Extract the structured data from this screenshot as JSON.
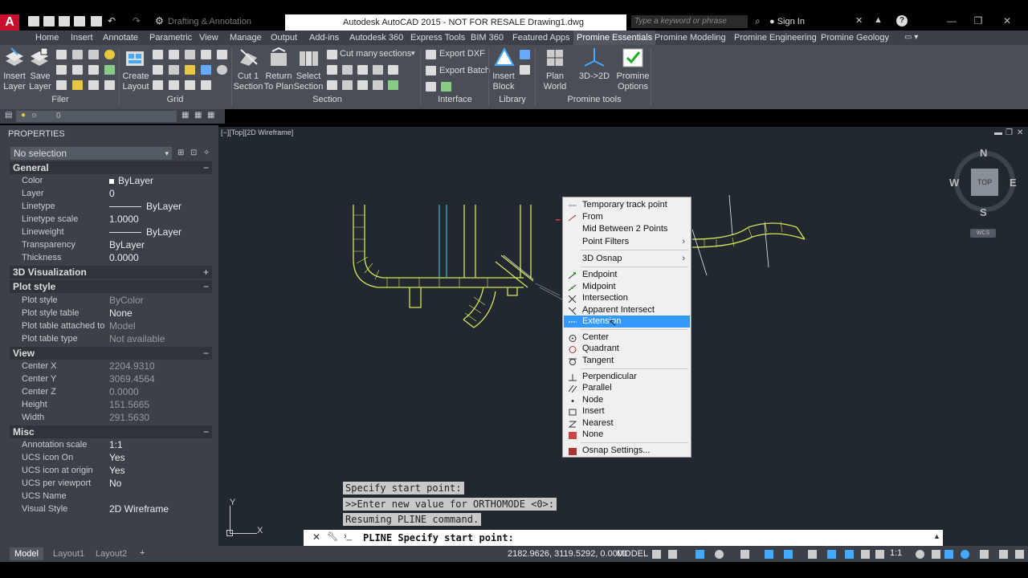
{
  "titlebar": {
    "workspace": "Drafting & Annotation",
    "title": "Autodesk AutoCAD 2015 - NOT FOR RESALE    Drawing1.dwg",
    "search_placeholder": "Type a keyword or phrase",
    "signin": "Sign In"
  },
  "tabs": [
    {
      "label": "Home"
    },
    {
      "label": "Insert"
    },
    {
      "label": "Annotate"
    },
    {
      "label": "Parametric"
    },
    {
      "label": "View"
    },
    {
      "label": "Manage"
    },
    {
      "label": "Output"
    },
    {
      "label": "Add-ins"
    },
    {
      "label": "Autodesk 360"
    },
    {
      "label": "Express Tools"
    },
    {
      "label": "BIM 360"
    },
    {
      "label": "Featured Apps"
    },
    {
      "label": "Promine Essentials"
    },
    {
      "label": "Promine Modeling"
    },
    {
      "label": "Promine Engineering"
    },
    {
      "label": "Promine Geology"
    }
  ],
  "ribbon": {
    "insert_layer": [
      "Insert",
      "Layer"
    ],
    "save_layer": [
      "Save",
      "Layer"
    ],
    "create_layout": [
      "Create",
      "Layout"
    ],
    "cut1_section": [
      "Cut 1",
      "Section"
    ],
    "return_to_plan": [
      "Return",
      "To Plan"
    ],
    "select_section": [
      "Select",
      "Section"
    ],
    "cut_many": "Cut many",
    "sections": "sections",
    "export_dxf": "Export DXF",
    "export_batch": "Export Batch",
    "insert_block": [
      "Insert",
      "Block"
    ],
    "plan_world": [
      "Plan",
      "World"
    ],
    "three_d_to_2d": "3D->2D",
    "promine_options": [
      "Promine",
      "Options"
    ],
    "panels": {
      "filer": "Filer",
      "grid": "Grid",
      "section": "Section",
      "interface": "Interface",
      "library": "Library",
      "promine_tools": "Promine tools"
    }
  },
  "layerbar": {
    "layer": "0"
  },
  "properties": {
    "title": "PROPERTIES",
    "selection": "No selection",
    "general": {
      "title": "General",
      "rows": [
        {
          "k": "Color",
          "v": "ByLayer"
        },
        {
          "k": "Layer",
          "v": "0"
        },
        {
          "k": "Linetype",
          "v": "ByLayer"
        },
        {
          "k": "Linetype scale",
          "v": "1.0000"
        },
        {
          "k": "Lineweight",
          "v": "ByLayer"
        },
        {
          "k": "Transparency",
          "v": "ByLayer"
        },
        {
          "k": "Thickness",
          "v": "0.0000"
        }
      ]
    },
    "viz_title": "3D Visualization",
    "plot": {
      "title": "Plot style",
      "rows": [
        {
          "k": "Plot style",
          "v": "ByColor"
        },
        {
          "k": "Plot style table",
          "v": "None"
        },
        {
          "k": "Plot table attached to",
          "v": "Model"
        },
        {
          "k": "Plot table type",
          "v": "Not available"
        }
      ]
    },
    "view": {
      "title": "View",
      "rows": [
        {
          "k": "Center X",
          "v": "2204.9310"
        },
        {
          "k": "Center Y",
          "v": "3069.4564"
        },
        {
          "k": "Center Z",
          "v": "0.0000"
        },
        {
          "k": "Height",
          "v": "151.5665"
        },
        {
          "k": "Width",
          "v": "291.5630"
        }
      ]
    },
    "misc": {
      "title": "Misc",
      "rows": [
        {
          "k": "Annotation scale",
          "v": "1:1"
        },
        {
          "k": "UCS icon On",
          "v": "Yes"
        },
        {
          "k": "UCS icon at origin",
          "v": "Yes"
        },
        {
          "k": "UCS per viewport",
          "v": "No"
        },
        {
          "k": "UCS Name",
          "v": ""
        },
        {
          "k": "Visual Style",
          "v": "2D Wireframe"
        }
      ]
    }
  },
  "viewport_label": "[−][Top][2D Wireframe]",
  "compass": {
    "n": "N",
    "s": "S",
    "e": "E",
    "w": "W",
    "top": "TOP",
    "ucs": "WCS"
  },
  "ucs_axis": {
    "x": "X",
    "y": "Y"
  },
  "context_menu": [
    {
      "label": "Temporary track point"
    },
    {
      "label": "From"
    },
    {
      "label": "Mid Between 2 Points"
    },
    {
      "label": "Point Filters"
    },
    {
      "label": "3D Osnap"
    },
    {
      "label": "Endpoint"
    },
    {
      "label": "Midpoint"
    },
    {
      "label": "Intersection"
    },
    {
      "label": "Apparent Intersect"
    },
    {
      "label": "Extension"
    },
    {
      "label": "Center"
    },
    {
      "label": "Quadrant"
    },
    {
      "label": "Tangent"
    },
    {
      "label": "Perpendicular"
    },
    {
      "label": "Parallel"
    },
    {
      "label": "Node"
    },
    {
      "label": "Insert"
    },
    {
      "label": "Nearest"
    },
    {
      "label": "None"
    },
    {
      "label": "Osnap Settings..."
    }
  ],
  "command": {
    "history": [
      "Specify start point:",
      ">>Enter new value for ORTHOMODE <0>:",
      "Resuming PLINE command."
    ],
    "current": "PLINE Specify start point:"
  },
  "status": {
    "layout_tabs": [
      "Model",
      "Layout1",
      "Layout2"
    ],
    "coords": "2182.9626, 3119.5292, 0.0000",
    "model": "MODEL",
    "scale": "1:1"
  }
}
